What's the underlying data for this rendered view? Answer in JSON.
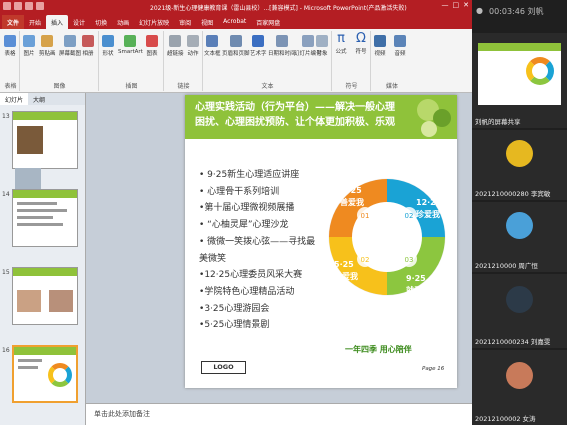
{
  "titlebar": {
    "title": "2021级-新生心理健康教育课（雷山县校）...[兼容模式] - Microsoft PowerPoint(产品激活失败)",
    "controls": [
      "—",
      "□",
      "✕"
    ]
  },
  "tabs": [
    "文件",
    "开始",
    "插入",
    "设计",
    "切换",
    "动画",
    "幻灯片放映",
    "审阅",
    "视图",
    "Acrobat",
    "百家网盘"
  ],
  "ribbon": {
    "groups": [
      {
        "label": "表格",
        "buttons": [
          "表格"
        ]
      },
      {
        "label": "图像",
        "buttons": [
          "图片",
          "剪贴画",
          "屏幕截图",
          "相册"
        ]
      },
      {
        "label": "插图",
        "buttons": [
          "形状",
          "SmartArt",
          "图表"
        ]
      },
      {
        "label": "链接",
        "buttons": [
          "超链接",
          "动作"
        ]
      },
      {
        "label": "文本",
        "buttons": [
          "文本框",
          "页眉和页脚",
          "艺术字",
          "日期和时间",
          "幻灯片编号",
          "对象"
        ]
      },
      {
        "label": "符号",
        "buttons": [
          "公式",
          "符号"
        ]
      },
      {
        "label": "媒体",
        "buttons": [
          "视频",
          "音频"
        ]
      }
    ]
  },
  "panel": {
    "tabs": [
      "幻灯片",
      "大纲"
    ],
    "slide_numbers": [
      "13",
      "14",
      "15",
      "16"
    ]
  },
  "slide": {
    "title": "心理实践活动（行为平台）——解决一般心理困扰、心理困扰预防、让个体更加积极、乐观",
    "bullets": [
      "9·25新生心理适应讲座",
      "心理骨干系列培训",
      "第十届心理微视频展播",
      "“心柚灵犀”心理沙龙",
      "微微一笑拨心弦——寻找最美微笑",
      "12·25心理委员风采大赛",
      "学院特色心理精品活动",
      "3·25心理游园会",
      "5·25心理情景剧"
    ],
    "cycle": [
      {
        "num": "01",
        "date": "3·25",
        "label": "善爱我",
        "color": "#ef8a20"
      },
      {
        "num": "02",
        "date": "12·25",
        "label": "珍爱我",
        "color": "#1aa3d5"
      },
      {
        "num": "03",
        "date": "9·25",
        "label": "就爱我",
        "color": "#8cc63f"
      },
      {
        "num": "02",
        "date": "5·25",
        "label": "我爱我",
        "color": "#f7c11b"
      }
    ],
    "slogan": "一年四季  用心陪伴",
    "logo": "LOGO",
    "page": "Page  16"
  },
  "notes": "单击此处添加备注",
  "meeting": {
    "header": "00:03:46  刘帆",
    "participants": [
      {
        "name": "刘帆的屏幕共享"
      },
      {
        "name": "2021210000280 李宾敏"
      },
      {
        "name": "2021210000 周广恒"
      },
      {
        "name": "2021210000234 刘嘉雯"
      },
      {
        "name": "20212100002 女涛"
      }
    ]
  },
  "colors": {
    "accent": "#b41e23",
    "slide_green": "#8fc23a"
  }
}
